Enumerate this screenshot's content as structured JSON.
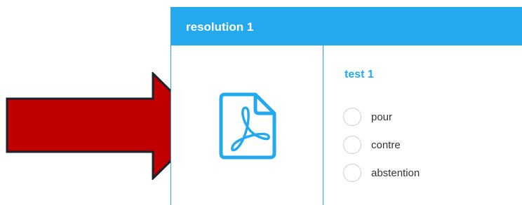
{
  "header": {
    "title": "resolution 1"
  },
  "document": {
    "icon": "pdf-file-icon",
    "icon_color": "#25a9ee"
  },
  "question": {
    "title": "test 1",
    "options": [
      {
        "label": "pour",
        "selected": false
      },
      {
        "label": "contre",
        "selected": false
      },
      {
        "label": "abstention",
        "selected": false
      }
    ]
  },
  "annotation": {
    "icon": "right-arrow-icon",
    "fill_color": "#c00000",
    "stroke_color": "#1a2230"
  },
  "colors": {
    "accent": "#25a9ee",
    "text": "#333333",
    "radio_border": "#cfcfcf"
  }
}
